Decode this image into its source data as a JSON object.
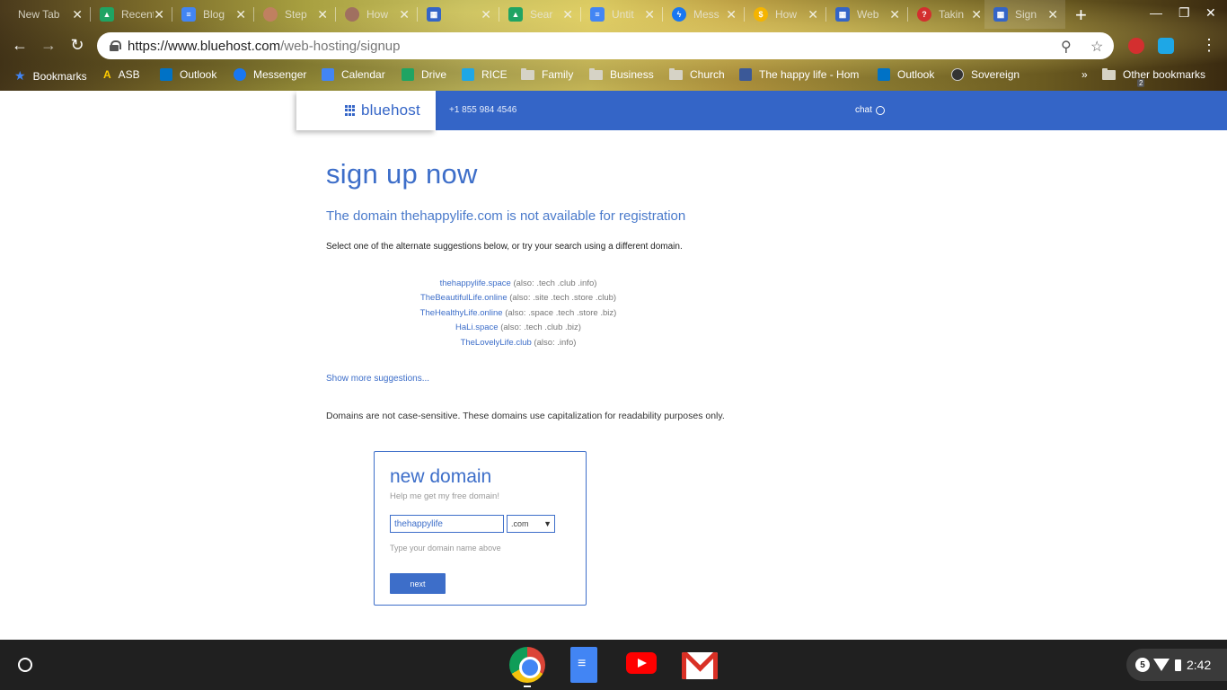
{
  "browser": {
    "tabs": [
      {
        "title": "New Tab",
        "favicon_color": "#00000000"
      },
      {
        "title": "Recent",
        "favicon_color": "#1fa463"
      },
      {
        "title": "Blog",
        "favicon_color": "#4285f4"
      },
      {
        "title": "Step",
        "favicon_color": "#c08060"
      },
      {
        "title": "How",
        "favicon_color": "#a07060"
      },
      {
        "title": "",
        "favicon_color": "#3465c7"
      },
      {
        "title": "Sear",
        "favicon_color": "#1fa463"
      },
      {
        "title": "Untit",
        "favicon_color": "#4285f4"
      },
      {
        "title": "Mess",
        "favicon_color": "#1877f2"
      },
      {
        "title": "How",
        "favicon_color": "#f4b400"
      },
      {
        "title": "Web",
        "favicon_color": "#3465c7"
      },
      {
        "title": "Takin",
        "favicon_color": "#d32f2f"
      },
      {
        "title": "Sign",
        "favicon_color": "#3465c7",
        "active": true
      }
    ],
    "url_host": "https://www.bluehost.com",
    "url_path": "/web-hosting/signup",
    "extension_badge": "2",
    "bookmarks": [
      {
        "label": "Bookmarks",
        "icon": "star-icon",
        "color": "#4285f4"
      },
      {
        "label": "ASB",
        "icon": "asb-icon",
        "color": "#ffcc00"
      },
      {
        "label": "Outlook",
        "icon": "outlook-icon",
        "color": "#0072c6"
      },
      {
        "label": "Messenger",
        "icon": "messenger-icon",
        "color": "#1877f2"
      },
      {
        "label": "Calendar",
        "icon": "calendar-icon",
        "color": "#4285f4"
      },
      {
        "label": "Drive",
        "icon": "drive-icon",
        "color": "#1fa463"
      },
      {
        "label": "RICE",
        "icon": "rice-icon",
        "color": "#1ea7e6"
      },
      {
        "label": "Family",
        "icon": "folder-icon",
        "color": "#d6d3c6"
      },
      {
        "label": "Business",
        "icon": "folder-icon",
        "color": "#d6d3c6"
      },
      {
        "label": "Church",
        "icon": "folder-icon",
        "color": "#d6d3c6"
      },
      {
        "label": "The happy life - Hom",
        "icon": "facebook-icon",
        "color": "#3b5998"
      },
      {
        "label": "Outlook",
        "icon": "outlook-icon",
        "color": "#0072c6"
      },
      {
        "label": "Sovereign",
        "icon": "sovereign-icon",
        "color": "#333333"
      }
    ],
    "overflow_label": "»",
    "other_bookmarks": "Other bookmarks"
  },
  "site": {
    "logo_text": "bluehost",
    "phone": "+1 855 984 4546",
    "chat_label": "chat",
    "brand_color": "#3465c7"
  },
  "page": {
    "heading": "sign up now",
    "unavailable_message": "The domain thehappylife.com is not available for registration",
    "instruction": "Select one of the alternate suggestions below, or try your search using a different domain.",
    "suggestions": [
      {
        "domain": "thehappylife.space",
        "also": "(also: .tech .club .info)"
      },
      {
        "domain": "TheBeautifulLife.online",
        "also": "(also: .site .tech .store .club)"
      },
      {
        "domain": "TheHealthyLife.online",
        "also": "(also: .space .tech .store .biz)"
      },
      {
        "domain": "HaLi.space",
        "also": "(also: .tech .club .biz)"
      },
      {
        "domain": "TheLovelyLife.club",
        "also": "(also: .info)"
      }
    ],
    "show_more": "Show more suggestions...",
    "case_note": "Domains are not case-sensitive. These domains use capitalization for readability purposes only."
  },
  "new_domain": {
    "title": "new domain",
    "subtitle": "Help me get my free domain!",
    "input_value": "thehappylife",
    "tld_selected": ".com",
    "hint": "Type your domain name above",
    "next_label": "next"
  },
  "shelf": {
    "notification_count": "5",
    "time": "2:42"
  }
}
